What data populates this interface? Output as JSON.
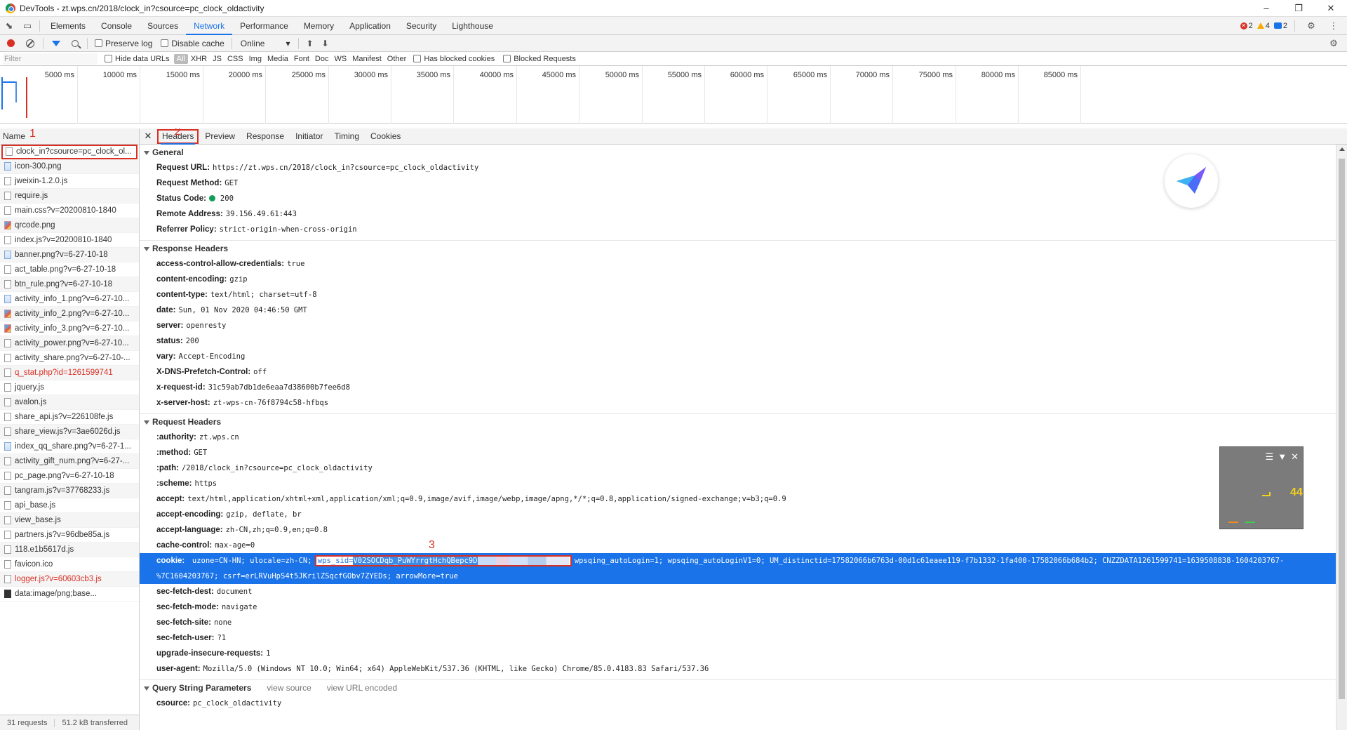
{
  "window": {
    "title": "DevTools - zt.wps.cn/2018/clock_in?csource=pc_clock_oldactivity"
  },
  "main_tabs": [
    "Elements",
    "Console",
    "Sources",
    "Network",
    "Performance",
    "Memory",
    "Application",
    "Security",
    "Lighthouse"
  ],
  "active_main_tab": "Network",
  "badges": {
    "errors": "2",
    "warnings": "4",
    "info": "2"
  },
  "toolbar": {
    "preserve_log": "Preserve log",
    "disable_cache": "Disable cache",
    "throttle": "Online"
  },
  "filter": {
    "placeholder": "Filter",
    "hide_data_urls": "Hide data URLs",
    "types": [
      "All",
      "XHR",
      "JS",
      "CSS",
      "Img",
      "Media",
      "Font",
      "Doc",
      "WS",
      "Manifest",
      "Other"
    ],
    "has_blocked_cookies": "Has blocked cookies",
    "blocked_requests": "Blocked Requests"
  },
  "timeline_ticks": [
    "5000 ms",
    "10000 ms",
    "15000 ms",
    "20000 ms",
    "25000 ms",
    "30000 ms",
    "35000 ms",
    "40000 ms",
    "45000 ms",
    "50000 ms",
    "55000 ms",
    "60000 ms",
    "65000 ms",
    "70000 ms",
    "75000 ms",
    "80000 ms",
    "85000 ms"
  ],
  "name_header": "Name",
  "requests": [
    {
      "name": "clock_in?csource=pc_clock_ol...",
      "icon": "doc",
      "color": "normal"
    },
    {
      "name": "icon-300.png",
      "icon": "img",
      "color": "normal"
    },
    {
      "name": "jweixin-1.2.0.js",
      "icon": "doc",
      "color": "normal"
    },
    {
      "name": "require.js",
      "icon": "doc",
      "color": "normal"
    },
    {
      "name": "main.css?v=20200810-1840",
      "icon": "doc",
      "color": "normal"
    },
    {
      "name": "qrcode.png",
      "icon": "imgc",
      "color": "normal"
    },
    {
      "name": "index.js?v=20200810-1840",
      "icon": "doc",
      "color": "normal"
    },
    {
      "name": "banner.png?v=6-27-10-18",
      "icon": "img",
      "color": "normal"
    },
    {
      "name": "act_table.png?v=6-27-10-18",
      "icon": "doc",
      "color": "normal"
    },
    {
      "name": "btn_rule.png?v=6-27-10-18",
      "icon": "doc",
      "color": "normal"
    },
    {
      "name": "activity_info_1.png?v=6-27-10...",
      "icon": "img",
      "color": "normal"
    },
    {
      "name": "activity_info_2.png?v=6-27-10...",
      "icon": "imgc",
      "color": "normal"
    },
    {
      "name": "activity_info_3.png?v=6-27-10...",
      "icon": "imgc",
      "color": "normal"
    },
    {
      "name": "activity_power.png?v=6-27-10...",
      "icon": "doc",
      "color": "normal"
    },
    {
      "name": "activity_share.png?v=6-27-10-...",
      "icon": "doc",
      "color": "normal"
    },
    {
      "name": "q_stat.php?id=1261599741",
      "icon": "doc",
      "color": "red"
    },
    {
      "name": "jquery.js",
      "icon": "doc",
      "color": "normal"
    },
    {
      "name": "avalon.js",
      "icon": "doc",
      "color": "normal"
    },
    {
      "name": "share_api.js?v=226108fe.js",
      "icon": "doc",
      "color": "normal"
    },
    {
      "name": "share_view.js?v=3ae6026d.js",
      "icon": "doc",
      "color": "normal"
    },
    {
      "name": "index_qq_share.png?v=6-27-1...",
      "icon": "img",
      "color": "normal"
    },
    {
      "name": "activity_gift_num.png?v=6-27-...",
      "icon": "doc",
      "color": "normal"
    },
    {
      "name": "pc_page.png?v=6-27-10-18",
      "icon": "doc",
      "color": "normal"
    },
    {
      "name": "tangram.js?v=37768233.js",
      "icon": "doc",
      "color": "normal"
    },
    {
      "name": "api_base.js",
      "icon": "doc",
      "color": "normal"
    },
    {
      "name": "view_base.js",
      "icon": "doc",
      "color": "normal"
    },
    {
      "name": "partners.js?v=96dbe85a.js",
      "icon": "doc",
      "color": "normal"
    },
    {
      "name": "118.e1b5617d.js",
      "icon": "doc",
      "color": "normal"
    },
    {
      "name": "favicon.ico",
      "icon": "doc",
      "color": "normal"
    },
    {
      "name": "logger.js?v=60603cb3.js",
      "icon": "doc",
      "color": "red"
    },
    {
      "name": "data:image/png;base...",
      "icon": "dark",
      "color": "normal"
    }
  ],
  "status": {
    "requests": "31 requests",
    "transferred": "51.2 kB transferred"
  },
  "detail_tabs": [
    "Headers",
    "Preview",
    "Response",
    "Initiator",
    "Timing",
    "Cookies"
  ],
  "active_detail_tab": "Headers",
  "annotations": [
    "1",
    "2",
    "3"
  ],
  "general": {
    "title": "General",
    "rows": [
      {
        "k": "Request URL:",
        "v": "https://zt.wps.cn/2018/clock_in?csource=pc_clock_oldactivity"
      },
      {
        "k": "Request Method:",
        "v": "GET"
      },
      {
        "k": "Status Code:",
        "v": "200"
      },
      {
        "k": "Remote Address:",
        "v": "39.156.49.61:443"
      },
      {
        "k": "Referrer Policy:",
        "v": "strict-origin-when-cross-origin"
      }
    ]
  },
  "response_headers": {
    "title": "Response Headers",
    "rows": [
      {
        "k": "access-control-allow-credentials:",
        "v": "true"
      },
      {
        "k": "content-encoding:",
        "v": "gzip"
      },
      {
        "k": "content-type:",
        "v": "text/html; charset=utf-8"
      },
      {
        "k": "date:",
        "v": "Sun, 01 Nov 2020 04:46:50 GMT"
      },
      {
        "k": "server:",
        "v": "openresty"
      },
      {
        "k": "status:",
        "v": "200"
      },
      {
        "k": "vary:",
        "v": "Accept-Encoding"
      },
      {
        "k": "X-DNS-Prefetch-Control:",
        "v": "off"
      },
      {
        "k": "x-request-id:",
        "v": "31c59ab7db1de6eaa7d38600b7fee6d8"
      },
      {
        "k": "x-server-host:",
        "v": "zt-wps-cn-76f8794c58-hfbqs"
      }
    ]
  },
  "request_headers": {
    "title": "Request Headers",
    "rows_before": [
      {
        "k": ":authority:",
        "v": "zt.wps.cn"
      },
      {
        "k": ":method:",
        "v": "GET"
      },
      {
        "k": ":path:",
        "v": "/2018/clock_in?csource=pc_clock_oldactivity"
      },
      {
        "k": ":scheme:",
        "v": "https"
      },
      {
        "k": "accept:",
        "v": "text/html,application/xhtml+xml,application/xml;q=0.9,image/avif,image/webp,image/apng,*/*;q=0.8,application/signed-exchange;v=b3;q=0.9"
      },
      {
        "k": "accept-encoding:",
        "v": "gzip, deflate, br"
      },
      {
        "k": "accept-language:",
        "v": "zh-CN,zh;q=0.9,en;q=0.8"
      },
      {
        "k": "cache-control:",
        "v": "max-age=0"
      }
    ],
    "cookie": {
      "k": "cookie:",
      "pre": "uzone=CN-HN; ulocale=zh-CN;",
      "sid_key": "wps_sid=",
      "sid_val": "V02SOCDqb_PuWYrrgtHchQBepc9D",
      "post": "wpsqing_autoLogin=1; wpsqing_autoLoginV1=0; UM_distinctid=17582066b6763d-00d1c61eaee119-f7b1332-1fa400-17582066b684b2; CNZZDATA1261599741=1639508838-1604203767-%7C1604203767; csrf=erLRVuHpS4t5JKrilZSqcfGObv7ZYEDs; arrowMore=true"
    },
    "rows_after": [
      {
        "k": "sec-fetch-dest:",
        "v": "document"
      },
      {
        "k": "sec-fetch-mode:",
        "v": "navigate"
      },
      {
        "k": "sec-fetch-site:",
        "v": "none"
      },
      {
        "k": "sec-fetch-user:",
        "v": "?1"
      },
      {
        "k": "upgrade-insecure-requests:",
        "v": "1"
      },
      {
        "k": "user-agent:",
        "v": "Mozilla/5.0 (Windows NT 10.0; Win64; x64) AppleWebKit/537.36 (KHTML, like Gecko) Chrome/85.0.4183.83 Safari/537.36"
      }
    ]
  },
  "query_params": {
    "title": "Query String Parameters",
    "view_source": "view source",
    "view_url_encoded": "view URL encoded",
    "rows": [
      {
        "k": "csource:",
        "v": "pc_clock_oldactivity"
      }
    ]
  },
  "fps_widget": {
    "value": "44"
  },
  "colors": {
    "accent": "#1a73e8",
    "annotation": "#d93025",
    "status_ok": "#0f9d58"
  }
}
